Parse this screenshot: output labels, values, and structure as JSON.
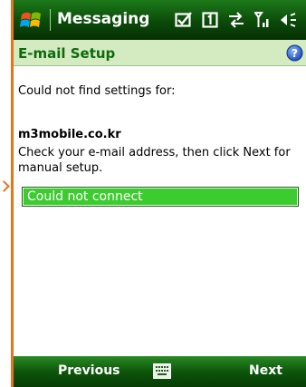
{
  "titlebar": {
    "app_title": "Messaging",
    "start_icon": "windows-flag-icon",
    "status_icons": [
      "envelope-check-icon",
      "sim-1-icon",
      "connectivity-icon",
      "signal-icon",
      "speaker-icon"
    ]
  },
  "header": {
    "title": "E-mail Setup",
    "help_icon": "help-icon"
  },
  "content": {
    "line1": "Could not find settings for:",
    "domain": "m3mobile.co.kr",
    "line2": "Check your e-mail address, then click Next for manual setup.",
    "status": "Could not connect"
  },
  "softkeys": {
    "left": "Previous",
    "center_icon": "keyboard-icon",
    "right": "Next"
  },
  "colors": {
    "title_bar": "#0b4a09",
    "section_header_bg": "#d4ebc2",
    "section_title": "#0d6a0d",
    "status_fill": "#3dcc2f",
    "softbar": "#0d560b",
    "edge_accent": "#e4741e"
  }
}
